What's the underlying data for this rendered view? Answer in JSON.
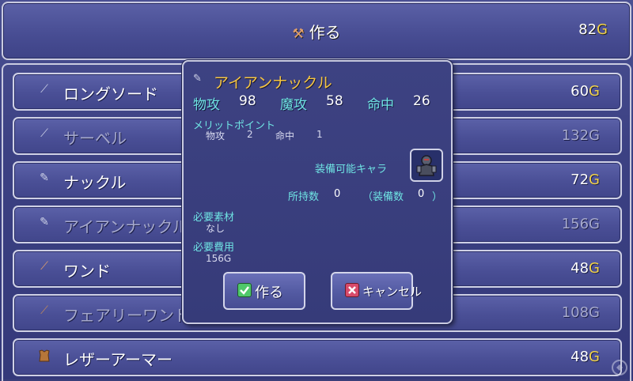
{
  "header": {
    "title": "作る",
    "gold_value": "82",
    "currency": "G"
  },
  "items": [
    {
      "icon": "sword-icon",
      "name": "ロングソード",
      "price": "60",
      "currency": "G",
      "dim": false
    },
    {
      "icon": "sword-icon",
      "name": "サーベル",
      "price": "132",
      "currency": "G",
      "dim": true
    },
    {
      "icon": "knuckle-icon",
      "name": "ナックル",
      "price": "72",
      "currency": "G",
      "dim": false
    },
    {
      "icon": "knuckle-icon",
      "name": "アイアンナックル",
      "price": "156",
      "currency": "G",
      "dim": true
    },
    {
      "icon": "wand-icon",
      "name": "ワンド",
      "price": "48",
      "currency": "G",
      "dim": false
    },
    {
      "icon": "wand-icon",
      "name": "フェアリーワンド",
      "price": "108",
      "currency": "G",
      "dim": true
    },
    {
      "icon": "armor-icon",
      "name": "レザーアーマー",
      "price": "48",
      "currency": "G",
      "dim": false
    }
  ],
  "popup": {
    "item_name": "アイアンナックル",
    "stats": [
      {
        "label": "物攻",
        "value": "98"
      },
      {
        "label": "魔攻",
        "value": "58"
      },
      {
        "label": "命中",
        "value": "26"
      }
    ],
    "merit_label": "メリットポイント",
    "merits": [
      {
        "label": "物攻",
        "value": "2"
      },
      {
        "label": "命中",
        "value": "1"
      }
    ],
    "equippable_label": "装備可能キャラ",
    "owned_label": "所持数",
    "owned_value": "0",
    "equipped_label": "（装備数",
    "equipped_value": "0",
    "equipped_close": "）",
    "materials_label": "必要素材",
    "materials_value": "なし",
    "cost_label": "必要費用",
    "cost_value": "156G",
    "confirm_label": "作る",
    "cancel_label": "キャンセル"
  },
  "colors": {
    "gold": "#f2d34a",
    "title_yellow": "#f5c542",
    "stat_cyan": "#6fe3e3",
    "window_blue": "#3d4282"
  }
}
